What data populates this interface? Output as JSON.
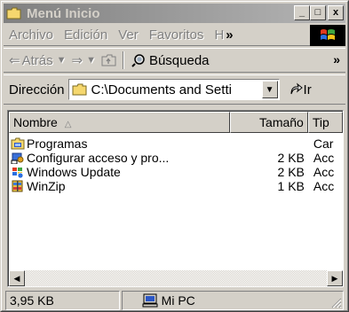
{
  "window": {
    "title": "Menú Inicio",
    "buttons": {
      "minimize": "_",
      "maximize": "□",
      "close": "x"
    }
  },
  "menubar": {
    "items": [
      "Archivo",
      "Edición",
      "Ver",
      "Favoritos",
      "H"
    ],
    "overflow": "»"
  },
  "toolbar": {
    "back_label": "Atrás",
    "search_label": "Búsqueda",
    "overflow": "»"
  },
  "address": {
    "label": "Dirección",
    "value": "C:\\Documents and Setti",
    "go_label": "Ir"
  },
  "list": {
    "columns": {
      "name": "Nombre",
      "size": "Tamaño",
      "type": "Tip"
    },
    "rows": [
      {
        "name": "Programas",
        "size": "",
        "type": "Car",
        "icon": "folder-programs-icon"
      },
      {
        "name": "Configurar acceso y pro...",
        "size": "2 KB",
        "type": "Acc",
        "icon": "shortcut-config-icon"
      },
      {
        "name": "Windows Update",
        "size": "2 KB",
        "type": "Acc",
        "icon": "windows-update-icon"
      },
      {
        "name": "WinZip",
        "size": "1 KB",
        "type": "Acc",
        "icon": "winzip-icon"
      }
    ]
  },
  "status": {
    "size": "3,95 KB",
    "zone": "Mi PC"
  },
  "colors": {
    "face": "#d4d0c8",
    "titlebar_inactive_start": "#808080",
    "titlebar_inactive_end": "#b5b5b5",
    "disabled_text": "#808080"
  }
}
